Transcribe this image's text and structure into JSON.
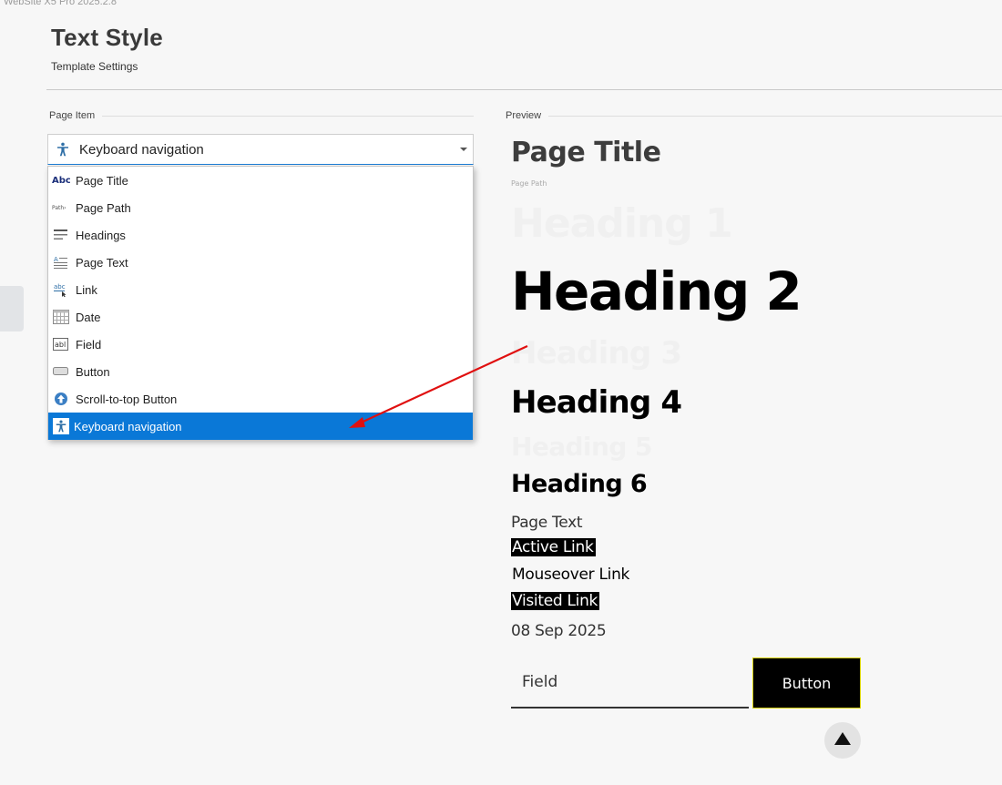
{
  "app": {
    "title": "WebSite X5 Pro 2025.2.8"
  },
  "header": {
    "title": "Text Style",
    "subtitle": "Template Settings"
  },
  "page_item": {
    "label": "Page Item",
    "selected": "Keyboard navigation",
    "items": [
      {
        "label": "Page Title",
        "icon": "abc-text-icon"
      },
      {
        "label": "Page Path",
        "icon": "page-path-icon"
      },
      {
        "label": "Headings",
        "icon": "headings-icon"
      },
      {
        "label": "Page Text",
        "icon": "page-text-icon"
      },
      {
        "label": "Link",
        "icon": "link-icon"
      },
      {
        "label": "Date",
        "icon": "calendar-icon"
      },
      {
        "label": "Field",
        "icon": "field-icon"
      },
      {
        "label": "Button",
        "icon": "button-icon"
      },
      {
        "label": "Scroll-to-top Button",
        "icon": "scroll-to-top-icon"
      },
      {
        "label": "Keyboard navigation",
        "icon": "accessibility-icon"
      }
    ]
  },
  "preview": {
    "label": "Preview",
    "page_title": "Page Title",
    "page_path": "Page Path",
    "heading1": "Heading 1",
    "heading2": "Heading 2",
    "heading3": "Heading 3",
    "heading4": "Heading 4",
    "heading5": "Heading 5",
    "heading6": "Heading 6",
    "page_text": "Page Text",
    "active_link": "Active Link",
    "mouseover_link": "Mouseover Link",
    "visited_link": "Visited Link",
    "date": "08 Sep 2025",
    "field": "Field",
    "button": "Button"
  },
  "colors": {
    "selection": "#0a78d7",
    "accessibility_icon": "#2f6fa6",
    "annotation_arrow": "#e01010"
  }
}
